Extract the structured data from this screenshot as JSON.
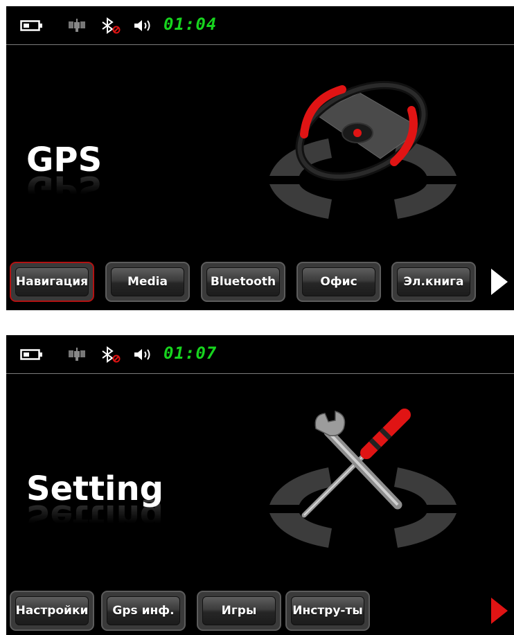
{
  "screens": [
    {
      "status": {
        "time": "01:04"
      },
      "title": "GPS",
      "art": "steering-wheel",
      "dock": [
        "Навигация",
        "Media",
        "Bluetooth",
        "Офис",
        "Эл.книга"
      ],
      "selected_index": 0,
      "arrow_color": "#ffffff"
    },
    {
      "status": {
        "time": "01:07"
      },
      "title": "Setting",
      "art": "wrench-screwdriver",
      "dock": [
        "Настройки",
        "Gps инф.",
        "Игры",
        "Инстру-ты"
      ],
      "selected_index": null,
      "arrow_color": "#e01414"
    }
  ],
  "colors": {
    "clock": "#17d41e",
    "accent_red": "#e01414",
    "background": "#000000"
  },
  "icons": [
    "battery-icon",
    "gps-icon",
    "bluetooth-off-icon",
    "volume-icon",
    "next-arrow-icon"
  ]
}
